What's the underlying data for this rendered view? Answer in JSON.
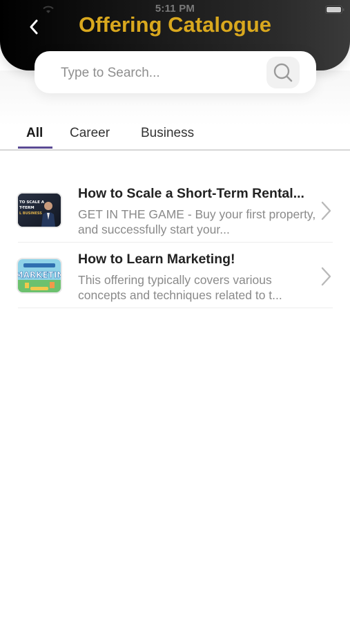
{
  "status_bar": {
    "time": "5:11 PM"
  },
  "header": {
    "title": "Offering Catalogue"
  },
  "search": {
    "placeholder": "Type to Search...",
    "value": ""
  },
  "tabs": [
    {
      "label": "All",
      "active": true
    },
    {
      "label": "Career",
      "active": false
    },
    {
      "label": "Business",
      "active": false
    }
  ],
  "offerings": [
    {
      "title": "How to Scale a Short-Term Rental...",
      "description": "GET IN THE GAME - Buy your first property, and successfully start your...",
      "thumbnail_text": "TO SCALE A T-TERM L BUSINESS"
    },
    {
      "title": "How to Learn Marketing!",
      "description": "This offering typically covers various concepts and techniques related to t...",
      "thumbnail_text": "MARKETIN"
    }
  ],
  "colors": {
    "title_gold": "#d9a81e",
    "tab_accent": "#5a4a94",
    "header_dark": "#111111"
  }
}
